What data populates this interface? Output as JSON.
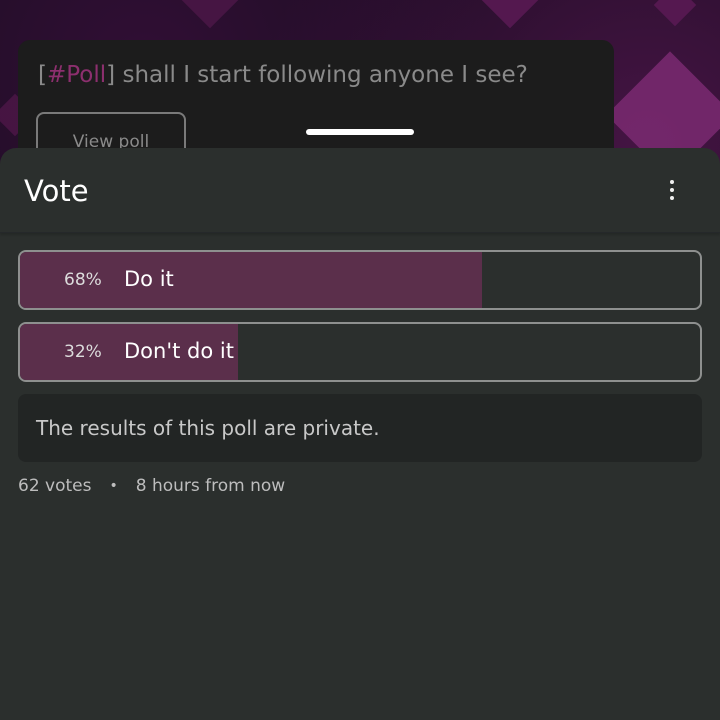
{
  "post": {
    "tag_open": "[",
    "tag": "#Poll",
    "tag_close": "]",
    "title": " shall I start following anyone I see?",
    "view_poll_label": "View poll"
  },
  "sheet": {
    "title": "Vote",
    "menu_icon": "more-vert-icon"
  },
  "poll": {
    "options": [
      {
        "percent_label": "68%",
        "label": "Do it",
        "fraction": 0.68
      },
      {
        "percent_label": "32%",
        "label": "Don't do it",
        "fraction": 0.32
      }
    ],
    "private_notice": "The results of this poll are private.",
    "votes": "62 votes",
    "separator": "•",
    "ends": "8 hours from now"
  },
  "colors": {
    "accent": "#8c2f6e",
    "result_fill": "#5b2f4b",
    "sheet_bg": "#2b2f2d"
  }
}
